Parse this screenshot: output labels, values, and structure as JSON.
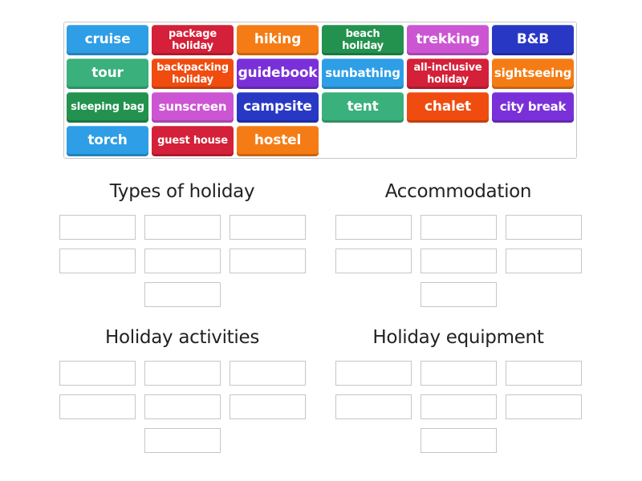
{
  "tiles": [
    {
      "label": "cruise",
      "color": "#2e9ee6"
    },
    {
      "label": "package holiday",
      "color": "#d42038"
    },
    {
      "label": "hiking",
      "color": "#f57c14"
    },
    {
      "label": "beach holiday",
      "color": "#22924e"
    },
    {
      "label": "trekking",
      "color": "#cc55d4"
    },
    {
      "label": "B&B",
      "color": "#2838c4"
    },
    {
      "label": "tour",
      "color": "#3ab07c"
    },
    {
      "label": "backpacking holiday",
      "color": "#f04c10"
    },
    {
      "label": "guidebook",
      "color": "#7a30d8"
    },
    {
      "label": "sunbathing",
      "color": "#2e9ee6"
    },
    {
      "label": "all-inclusive holiday",
      "color": "#d42038"
    },
    {
      "label": "sightseeing",
      "color": "#f57c14"
    },
    {
      "label": "sleeping bag",
      "color": "#22924e"
    },
    {
      "label": "sunscreen",
      "color": "#cc55d4"
    },
    {
      "label": "campsite",
      "color": "#2838c4"
    },
    {
      "label": "tent",
      "color": "#3ab07c"
    },
    {
      "label": "chalet",
      "color": "#f04c10"
    },
    {
      "label": "city break",
      "color": "#7a30d8"
    },
    {
      "label": "torch",
      "color": "#2e9ee6"
    },
    {
      "label": "guest house",
      "color": "#d42038"
    },
    {
      "label": "hostel",
      "color": "#f57c14"
    }
  ],
  "groups": [
    {
      "title": "Types of holiday"
    },
    {
      "title": "Accommodation"
    },
    {
      "title": "Holiday activities"
    },
    {
      "title": "Holiday equipment"
    }
  ]
}
